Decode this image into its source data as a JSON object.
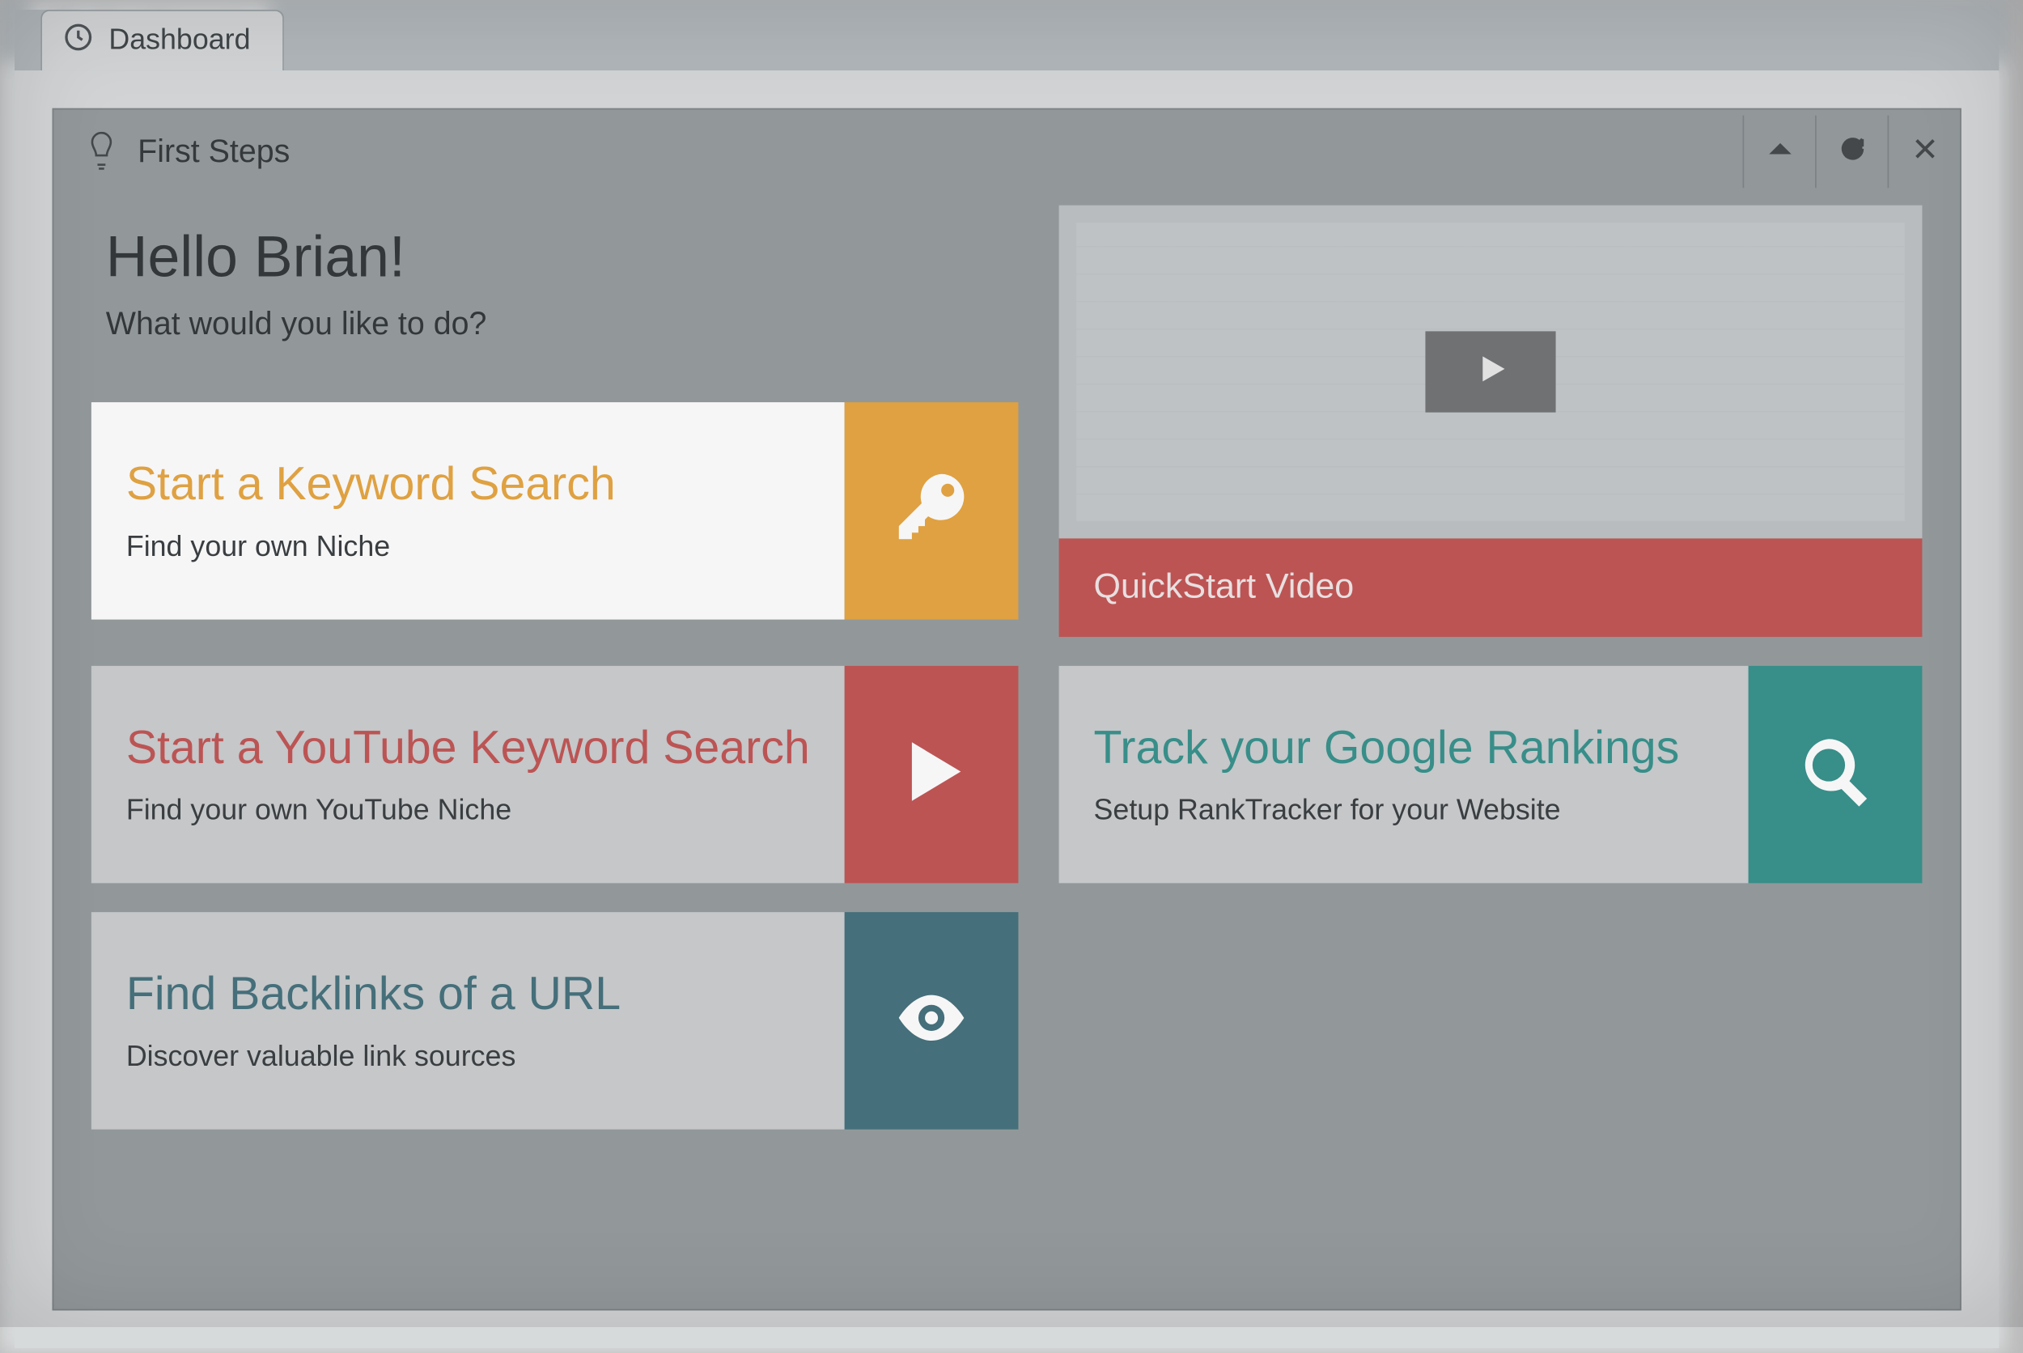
{
  "tab": {
    "label": "Dashboard"
  },
  "panel": {
    "title": "First Steps",
    "greeting_heading": "Hello Brian!",
    "greeting_sub": "What would you like to do?"
  },
  "video": {
    "label": "QuickStart Video"
  },
  "tiles": [
    {
      "title": "Start a Keyword Search",
      "sub": "Find your own Niche",
      "color": "orange",
      "icon": "key",
      "active": true
    },
    {
      "title": "Start a YouTube Keyword Search",
      "sub": "Find your own YouTube Niche",
      "color": "red",
      "icon": "play",
      "active": false
    },
    {
      "title": "Find Backlinks of a URL",
      "sub": "Discover valuable link sources",
      "color": "slate",
      "icon": "eye",
      "active": false
    },
    {
      "title": "Track your Google Rankings",
      "sub": "Setup RankTracker for your Website",
      "color": "teal",
      "icon": "magnifier",
      "active": false
    }
  ],
  "colors": {
    "orange": "#e6a33a",
    "red": "#c1504f",
    "teal": "#318f88",
    "slate": "#3f6d78"
  }
}
